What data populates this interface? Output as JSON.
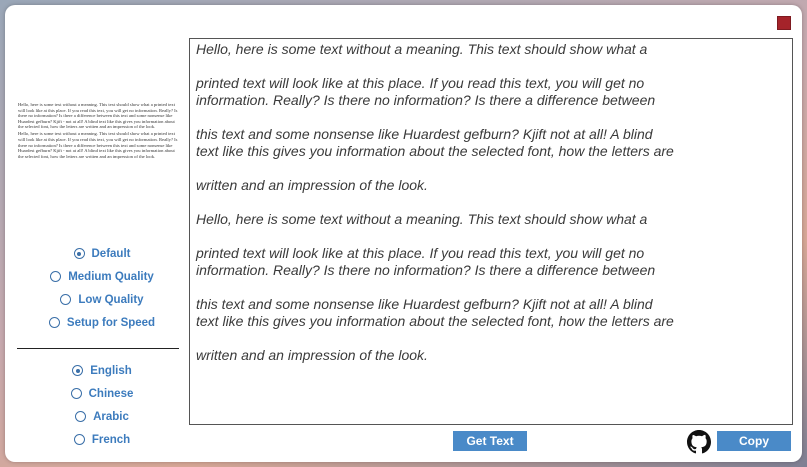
{
  "preview": {
    "paragraph1": "Hello, here is some text without a meaning. This text should show what a printed text will look like at this place. If you read this text, you will get no information. Really? Is there no information? Is there a difference between this text and some nonsense like Huardest gefburn? Kjift - not at all! A blind text like this gives you information about the selected font, how the letters are written and an impression of the look.",
    "paragraph2": "Hello, here is some text without a meaning. This text should show what a printed text will look like at this place. If you read this text, you will get no information. Really? Is there no information? Is there a difference between this text and some nonsense like Huardest gefburn? Kjift - not at all! A blind text like this gives you information about the selected font, how the letters are written and an impression of the look."
  },
  "quality": {
    "options": [
      {
        "label": "Default",
        "checked": true
      },
      {
        "label": "Medium Quality",
        "checked": false
      },
      {
        "label": "Low Quality",
        "checked": false
      },
      {
        "label": "Setup for Speed",
        "checked": false
      }
    ]
  },
  "language": {
    "options": [
      {
        "label": "English",
        "checked": true
      },
      {
        "label": "Chinese",
        "checked": false
      },
      {
        "label": "Arabic",
        "checked": false
      },
      {
        "label": "French",
        "checked": false
      }
    ]
  },
  "text": {
    "lines": [
      "Hello, here is some text without a meaning. This text should show what a",
      "",
      "printed text will look like at this place. If you read this text, you will get no",
      "information. Really? Is there no information? Is there a difference between",
      "",
      "this text and some nonsense like Huardest gefburn? Kjift not at all! A blind",
      "text like this gives you information about the selected font, how the letters are",
      "",
      "written and an impression of the look.",
      "",
      "Hello, here is some text without a meaning. This text should show what a",
      "",
      "printed text will look like at this place. If you read this text, you will get no",
      "information. Really? Is there no information? Is there a difference between",
      "",
      "this text and some nonsense like Huardest gefburn? Kjift not at all! A blind",
      "text like this gives you information about the selected font, how the letters are",
      "",
      "written and an impression of the look."
    ]
  },
  "buttons": {
    "get_text": "Get Text",
    "copy": "Copy"
  },
  "icons": {
    "close": "close-icon",
    "github": "github-icon"
  },
  "colors": {
    "accent": "#4a8ac8",
    "close": "#a5232a",
    "label": "#3c7bbd"
  }
}
